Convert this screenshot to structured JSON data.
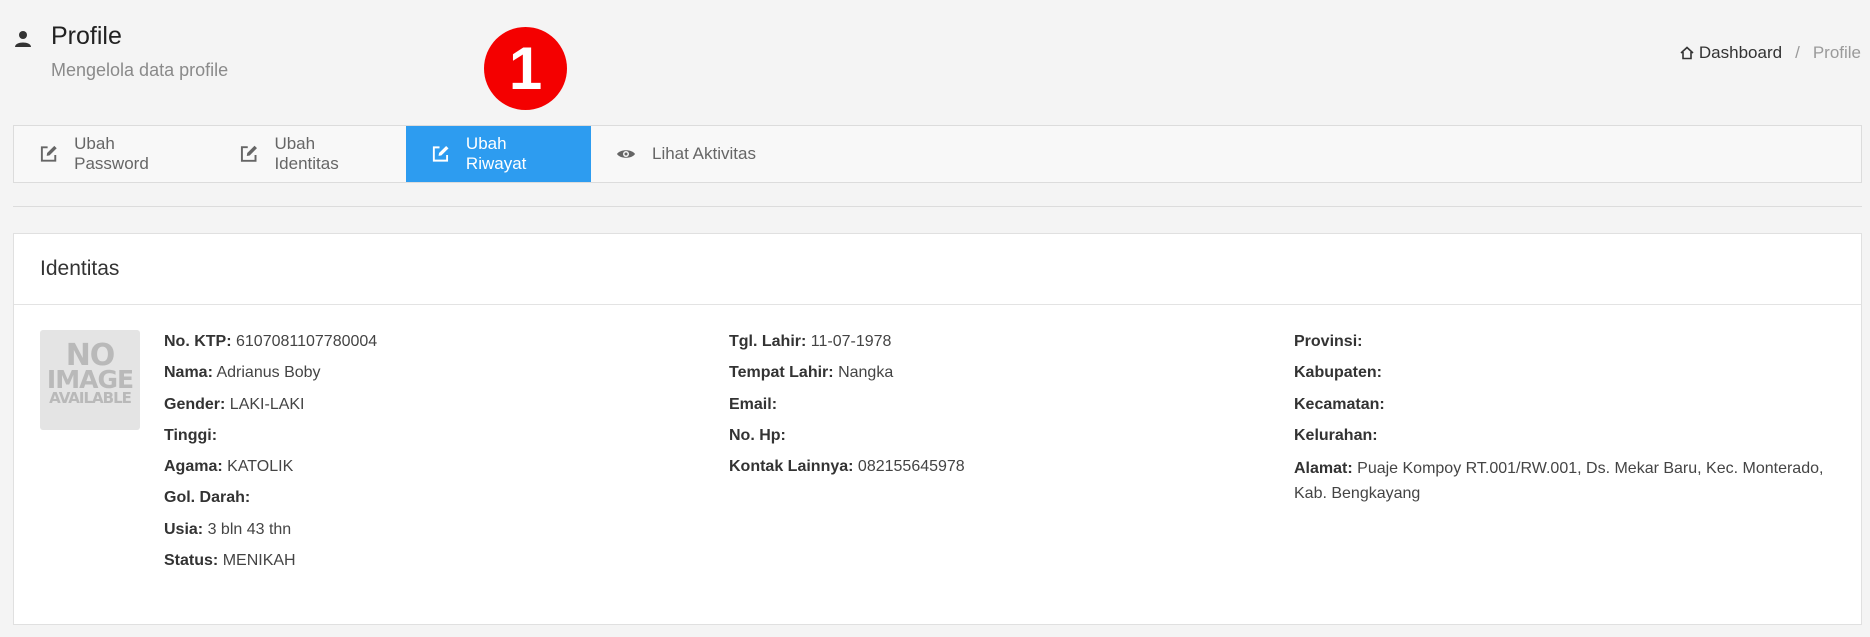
{
  "header": {
    "title": "Profile",
    "subtitle": "Mengelola data profile",
    "annotation_badge": "1"
  },
  "breadcrumb": {
    "home": "Dashboard",
    "separator": "/",
    "current": "Profile"
  },
  "tabs": [
    {
      "label": "Ubah Password",
      "icon": "edit-icon",
      "active": false
    },
    {
      "label": "Ubah Identitas",
      "icon": "edit-icon",
      "active": false
    },
    {
      "label": "Ubah Riwayat",
      "icon": "edit-icon",
      "active": true
    },
    {
      "label": "Lihat Aktivitas",
      "icon": "eye-icon",
      "active": false
    }
  ],
  "card": {
    "title": "Identitas",
    "photo": {
      "line1": "NO",
      "line2": "IMAGE",
      "line3": "AVAILABLE"
    },
    "col1": [
      {
        "label": "No. KTP:",
        "value": "6107081107780004"
      },
      {
        "label": "Nama:",
        "value": "Adrianus Boby"
      },
      {
        "label": "Gender:",
        "value": "LAKI-LAKI"
      },
      {
        "label": "Tinggi:",
        "value": ""
      },
      {
        "label": "Agama:",
        "value": "KATOLIK"
      },
      {
        "label": "Gol. Darah:",
        "value": ""
      },
      {
        "label": "Usia:",
        "value": "3 bln 43 thn"
      },
      {
        "label": "Status:",
        "value": "MENIKAH"
      }
    ],
    "col2": [
      {
        "label": "Tgl. Lahir:",
        "value": "11-07-1978"
      },
      {
        "label": "Tempat Lahir:",
        "value": "Nangka"
      },
      {
        "label": "Email:",
        "value": ""
      },
      {
        "label": "No. Hp:",
        "value": ""
      },
      {
        "label": "Kontak Lainnya:",
        "value": "082155645978"
      }
    ],
    "col3": [
      {
        "label": "Provinsi:",
        "value": ""
      },
      {
        "label": "Kabupaten:",
        "value": ""
      },
      {
        "label": "Kecamatan:",
        "value": ""
      },
      {
        "label": "Kelurahan:",
        "value": ""
      },
      {
        "label": "Alamat:",
        "value": "Puaje Kompoy RT.001/RW.001, Ds. Mekar Baru, Kec. Monterado, Kab. Bengkayang"
      }
    ]
  },
  "colors": {
    "active_tab": "#2d9cf0",
    "badge": "#f40000",
    "background": "#f4f4f4"
  }
}
